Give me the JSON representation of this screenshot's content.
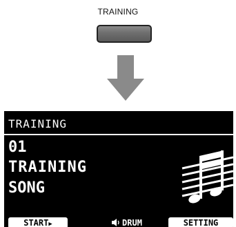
{
  "hardware_button": {
    "label": "TRAINING"
  },
  "display": {
    "title": "TRAINING",
    "song_number": "01",
    "song_name_line1": "TRAINING",
    "song_name_line2": "SONG",
    "icon": "music-notes-icon",
    "softkeys": {
      "start": "START",
      "start_arrow": "▶",
      "drum_icon": "speaker-icon",
      "drum": "DRUM",
      "setting": "SETTING"
    }
  },
  "colors": {
    "screen_bg": "#000000",
    "screen_fg": "#ffffff",
    "button_fill": "#6e6e6e",
    "arrow": "#8a8a8a"
  }
}
